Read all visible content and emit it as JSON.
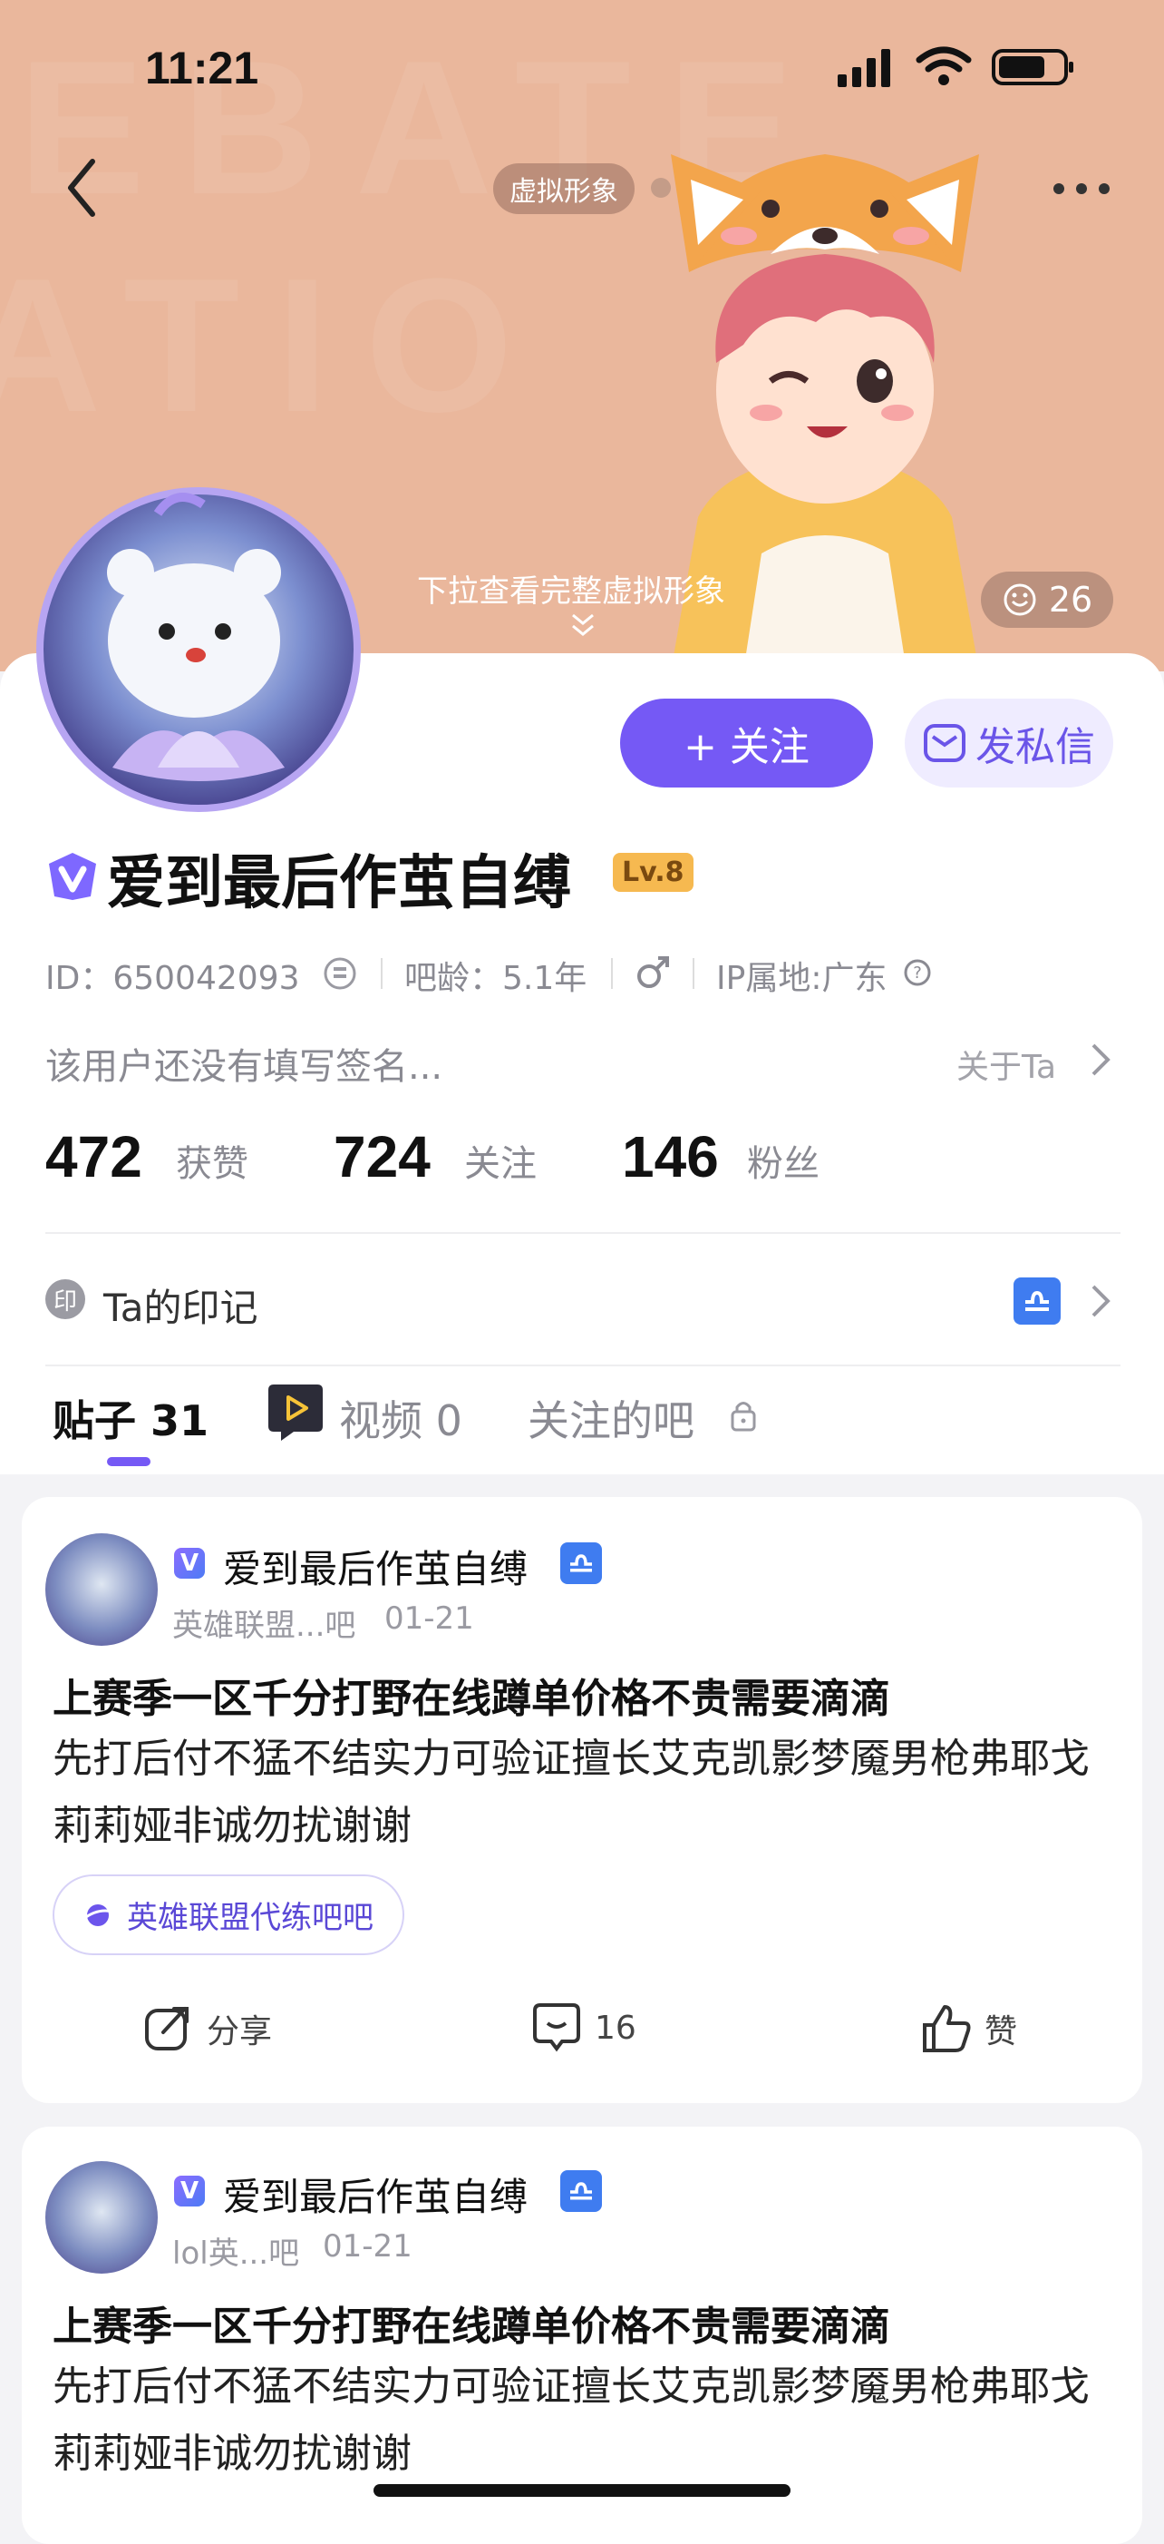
{
  "status_bar": {
    "time": "11:21"
  },
  "header": {
    "avatar_pill": "虚拟形象",
    "pull_hint": "下拉查看完整虚拟形象",
    "likes_count": "26"
  },
  "profile": {
    "follow_label": "+ 关注",
    "message_label": "发私信",
    "username": "爱到最后作茧自缚",
    "level": "Lv.8",
    "id_text": "ID：650042093",
    "bar_age": "吧龄：5.1年",
    "ip_location": "IP属地:广东",
    "signature": "该用户还没有填写签名...",
    "about_label": "关于Ta",
    "stats": [
      {
        "value": "472",
        "label": "获赞"
      },
      {
        "value": "724",
        "label": "关注"
      },
      {
        "value": "146",
        "label": "粉丝"
      }
    ],
    "marks_label": "Ta的印记",
    "marks_icon_label": "印"
  },
  "tabs": [
    {
      "label": "贴子",
      "count": "31"
    },
    {
      "label": "视频",
      "count": "0"
    },
    {
      "label": "关注的吧",
      "count": ""
    }
  ],
  "posts": [
    {
      "author": "爱到最后作茧自缚",
      "forum": "英雄联盟...吧",
      "date": "01-21",
      "title": "上赛季一区千分打野在线蹲单价格不贵需要滴滴",
      "body": "先打后付不猛不结实力可验证擅长艾克凯影梦魇男枪弗耶戈莉莉娅非诚勿扰谢谢",
      "tag": "英雄联盟代练吧吧",
      "share_label": "分享",
      "comment_count": "16",
      "like_label": "赞"
    },
    {
      "author": "爱到最后作茧自缚",
      "forum": "lol英...吧",
      "date": "01-21",
      "title": "上赛季一区千分打野在线蹲单价格不贵需要滴滴",
      "body": "先打后付不猛不结实力可验证擅长艾克凯影梦魇男枪弗耶戈莉莉娅非诚勿扰谢谢"
    }
  ],
  "colors": {
    "accent": "#7559f5",
    "banner": "#eab79c",
    "libra": "#3f7cf0"
  }
}
